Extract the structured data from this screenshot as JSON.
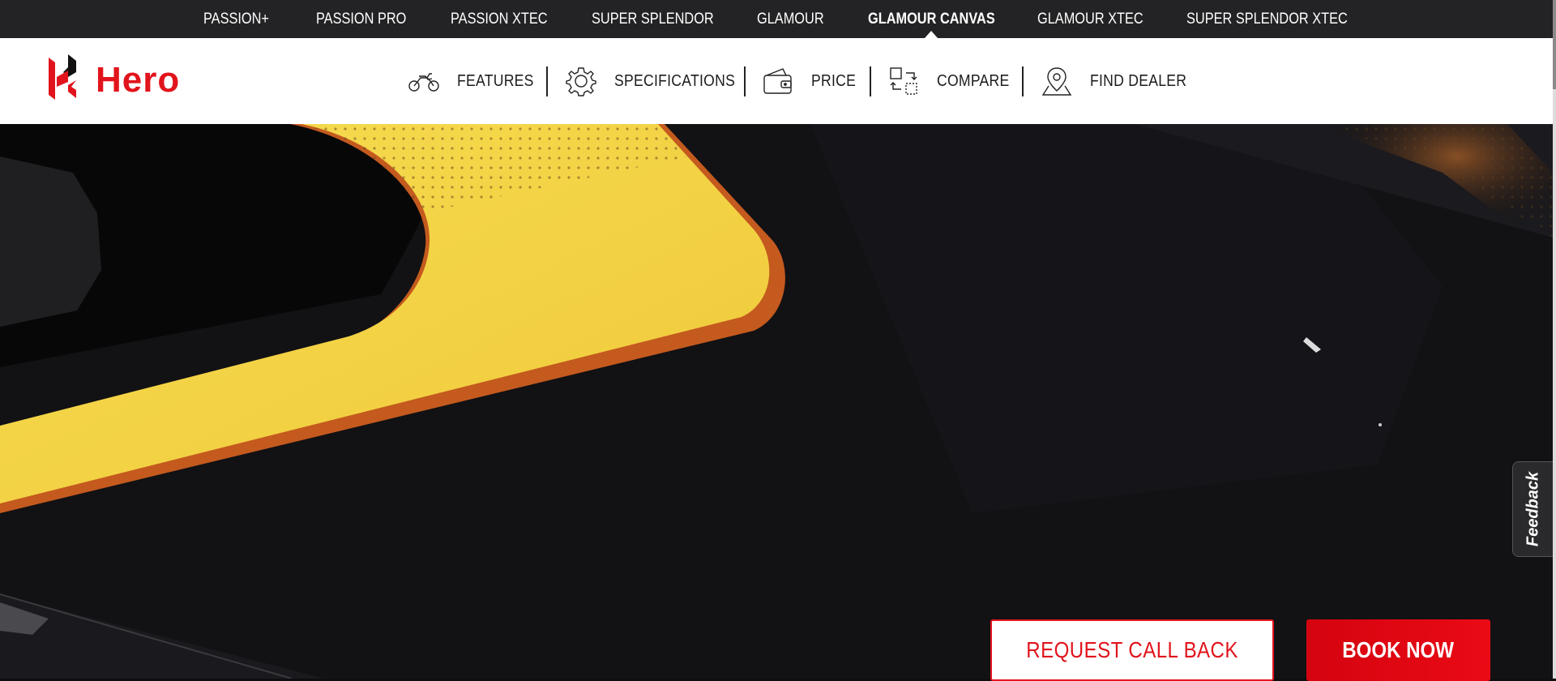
{
  "model_bar": {
    "items": [
      {
        "label": "PASSION+"
      },
      {
        "label": "PASSION PRO"
      },
      {
        "label": "PASSION XTEC"
      },
      {
        "label": "SUPER SPLENDOR"
      },
      {
        "label": "GLAMOUR"
      },
      {
        "label": "GLAMOUR CANVAS",
        "active": true
      },
      {
        "label": "GLAMOUR XTEC"
      },
      {
        "label": "SUPER SPLENDOR XTEC"
      }
    ]
  },
  "header": {
    "logo_text": "Hero",
    "nav": [
      {
        "label": "FEATURES",
        "icon": "motorcycle-icon"
      },
      {
        "label": "SPECIFICATIONS",
        "icon": "gear-icon"
      },
      {
        "label": "PRICE",
        "icon": "wallet-icon"
      },
      {
        "label": "COMPARE",
        "icon": "compare-icon"
      },
      {
        "label": "FIND DEALER",
        "icon": "map-pin-icon"
      }
    ]
  },
  "hero": {
    "feedback_label": "Feedback",
    "request_callback_label": "REQUEST CALL BACK",
    "book_now_label": "BOOK NOW"
  },
  "colors": {
    "brand_red": "#e1141c",
    "model_bar_bg": "#232325",
    "tank_yellow": "#f4d44a"
  }
}
